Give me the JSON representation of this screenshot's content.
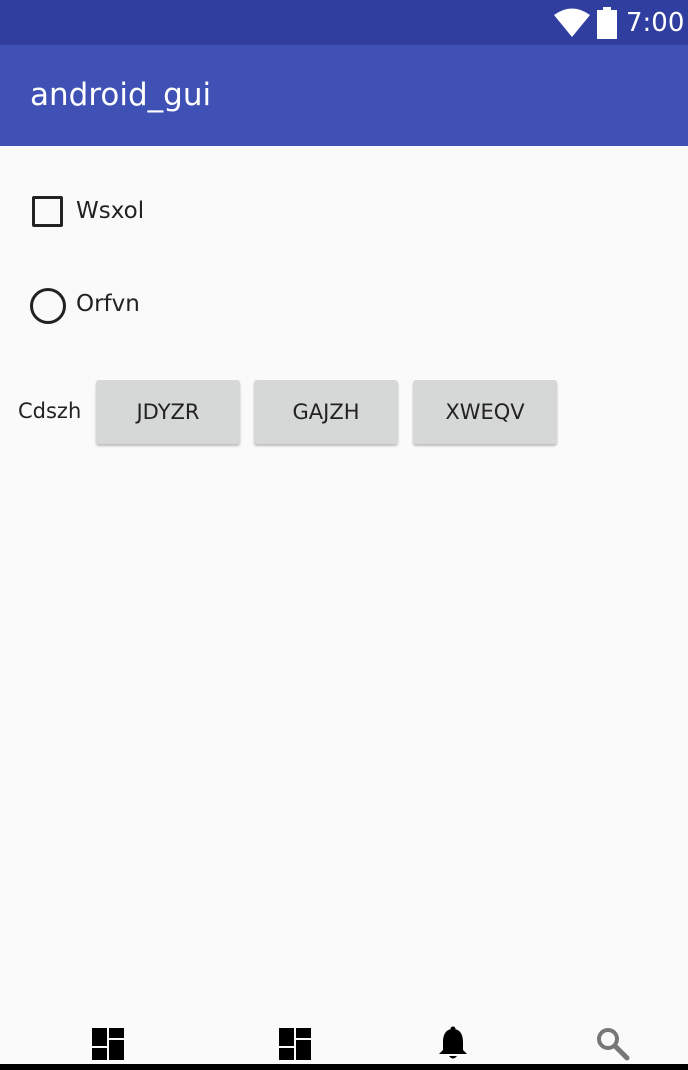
{
  "status_bar": {
    "time": "7:00",
    "icons": [
      "wifi-icon",
      "battery-icon"
    ],
    "background": "#303f9f"
  },
  "app_bar": {
    "title": "android_gui",
    "background": "#3f51b5"
  },
  "checkbox": {
    "label": "Wsxol",
    "checked": false
  },
  "radio": {
    "label": "Orfvn",
    "selected": false
  },
  "button_group": {
    "label": "Cdszh",
    "buttons": [
      {
        "label": "JDYZR"
      },
      {
        "label": "GAJZH"
      },
      {
        "label": "XWEQV"
      }
    ]
  },
  "bottom_nav": {
    "items": [
      {
        "icon": "dashboard-icon"
      },
      {
        "icon": "dashboard-icon"
      },
      {
        "icon": "notifications-icon"
      },
      {
        "icon": "search-icon"
      }
    ]
  }
}
